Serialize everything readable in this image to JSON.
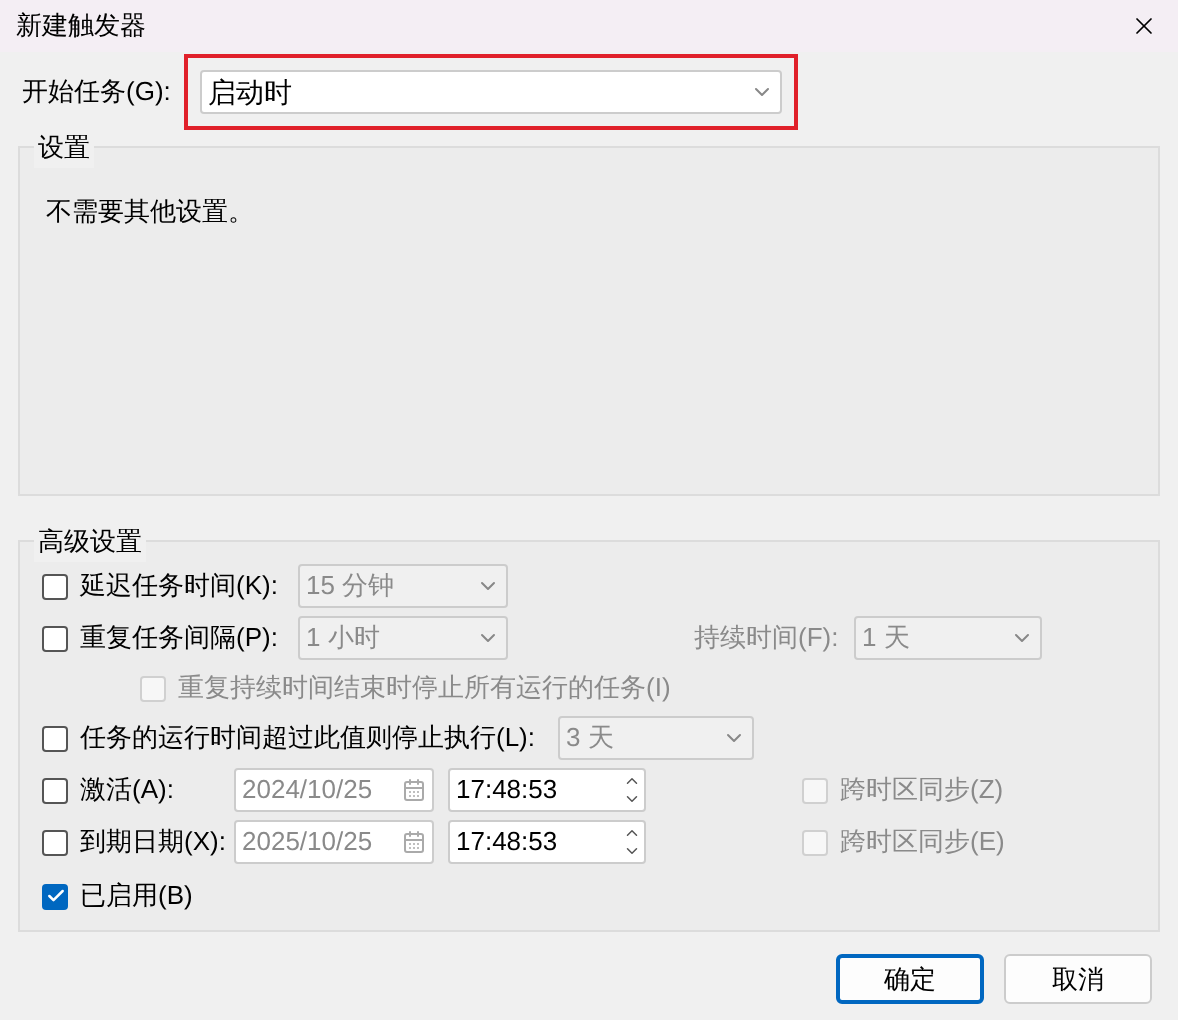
{
  "window": {
    "title": "新建触发器"
  },
  "begin_task": {
    "label": "开始任务(G):",
    "value": "启动时",
    "highlighted": true
  },
  "settings": {
    "title": "设置",
    "text": "不需要其他设置。"
  },
  "advanced": {
    "title": "高级设置",
    "delay": {
      "label": "延迟任务时间(K):",
      "checked": false,
      "value": "15 分钟",
      "disabled": true
    },
    "repeat": {
      "label": "重复任务间隔(P):",
      "checked": false,
      "value": "1 小时",
      "disabled": true,
      "duration_label": "持续时间(F):",
      "duration_value": "1 天"
    },
    "stop_all": {
      "label": "重复持续时间结束时停止所有运行的任务(I)",
      "checked": false,
      "disabled": true
    },
    "stop_if": {
      "label": "任务的运行时间超过此值则停止执行(L):",
      "checked": false,
      "value": "3 天",
      "disabled": true
    },
    "activate": {
      "label": "激活(A):",
      "checked": false,
      "date": "2024/10/25",
      "time": "17:48:53",
      "disabled": true,
      "sync_label": "跨时区同步(Z)",
      "sync_checked": false
    },
    "expire": {
      "label": "到期日期(X):",
      "checked": false,
      "date": "2025/10/25",
      "time": "17:48:53",
      "disabled": true,
      "sync_label": "跨时区同步(E)",
      "sync_checked": false
    },
    "enabled": {
      "label": "已启用(B)",
      "checked": true
    }
  },
  "buttons": [
    {
      "label": "确定",
      "default": true
    },
    {
      "label": "取消",
      "default": false
    }
  ]
}
